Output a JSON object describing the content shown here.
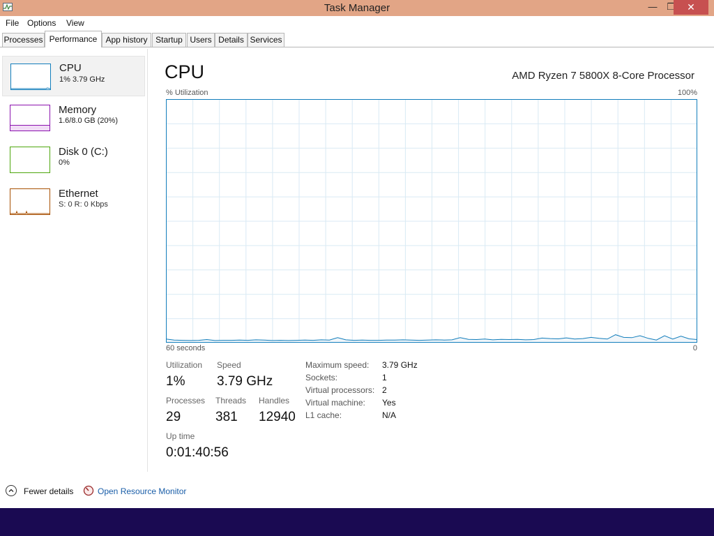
{
  "window": {
    "title": "Task Manager",
    "minimize_glyph": "—",
    "maximize_glyph": "❐",
    "close_glyph": "✕",
    "title_bar_color": "#e2a586"
  },
  "menu": [
    "File",
    "Options",
    "View"
  ],
  "tabs": [
    "Processes",
    "Performance",
    "App history",
    "Startup",
    "Users",
    "Details",
    "Services"
  ],
  "active_tab": "Performance",
  "sidebar": {
    "items": [
      {
        "name": "CPU",
        "sub": "1% 3.79 GHz",
        "color": "#117dbb",
        "selected": true
      },
      {
        "name": "Memory",
        "sub": "1.6/8.0 GB (20%)",
        "color": "#8b12ae",
        "selected": false
      },
      {
        "name": "Disk 0 (C:)",
        "sub": "0%",
        "color": "#4da60c",
        "selected": false
      },
      {
        "name": "Ethernet",
        "sub": "S: 0 R: 0 Kbps",
        "color": "#a74f01",
        "selected": false
      }
    ]
  },
  "main": {
    "title": "CPU",
    "model": "AMD Ryzen 7 5800X 8-Core Processor",
    "graph": {
      "y_label": "% Utilization",
      "y_max_label": "100%",
      "x_left_label": "60 seconds",
      "x_right_label": "0",
      "line_color": "#117dbb",
      "grid_color": "#d9eaf4",
      "samples_percent": [
        1.2,
        0.8,
        0.7,
        0.6,
        0.7,
        1.0,
        0.6,
        0.7,
        0.7,
        0.8,
        0.7,
        0.9,
        0.8,
        0.6,
        0.7,
        0.6,
        0.7,
        0.8,
        0.7,
        0.9,
        0.8,
        1.8,
        0.9,
        0.7,
        0.8,
        0.7,
        0.7,
        0.8,
        0.8,
        0.9,
        0.8,
        0.7,
        0.8,
        0.9,
        0.8,
        0.9,
        1.8,
        1.1,
        1.0,
        1.2,
        0.9,
        1.1,
        1.0,
        1.1,
        0.9,
        1.0,
        1.6,
        1.4,
        1.3,
        1.7,
        1.2,
        1.4,
        1.9,
        1.5,
        1.2,
        3.0,
        1.9,
        1.8,
        2.6,
        1.5,
        0.8,
        2.6,
        1.2,
        2.4,
        1.3,
        1.0
      ]
    },
    "stats": {
      "utilization_label": "Utilization",
      "utilization": "1%",
      "speed_label": "Speed",
      "speed": "3.79 GHz",
      "processes_label": "Processes",
      "processes": "29",
      "threads_label": "Threads",
      "threads": "381",
      "handles_label": "Handles",
      "handles": "12940",
      "uptime_label": "Up time",
      "uptime": "0:01:40:56"
    },
    "details": [
      {
        "key": "Maximum speed:",
        "value": "3.79 GHz"
      },
      {
        "key": "Sockets:",
        "value": "1"
      },
      {
        "key": "Virtual processors:",
        "value": "2"
      },
      {
        "key": "Virtual machine:",
        "value": "Yes"
      },
      {
        "key": "L1 cache:",
        "value": "N/A"
      }
    ]
  },
  "footer": {
    "fewer_details": "Fewer details",
    "open_resource_monitor": "Open Resource Monitor"
  },
  "taskbar": {
    "color": "#1a0a52"
  }
}
